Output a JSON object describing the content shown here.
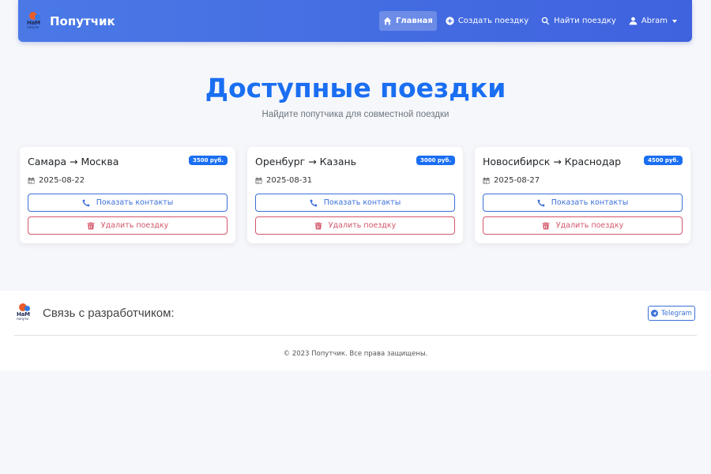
{
  "navbar": {
    "brand": "Попутчик",
    "logo_text": "НаМ",
    "logo_subtext": "попути",
    "items": [
      {
        "label": "Главная",
        "icon": "home-icon",
        "active": true
      },
      {
        "label": "Создать поездку",
        "icon": "plus-circle-icon",
        "active": false
      },
      {
        "label": "Найти поездку",
        "icon": "search-icon",
        "active": false
      },
      {
        "label": "Abram",
        "icon": "user-icon",
        "active": false
      }
    ]
  },
  "header": {
    "title": "Доступные поездки",
    "subtitle": "Найдите попутчика для совместной поездки"
  },
  "trips": [
    {
      "route": "Самара → Москва",
      "price": "3500 руб.",
      "date": "2025-08-22",
      "contacts_label": "Показать контакты",
      "delete_label": "Удалить поездку"
    },
    {
      "route": "Оренбург → Казань",
      "price": "3000 руб.",
      "date": "2025-08-31",
      "contacts_label": "Показать контакты",
      "delete_label": "Удалить поездку"
    },
    {
      "route": "Новосибирск → Краснодар",
      "price": "4500 руб.",
      "date": "2025-08-27",
      "contacts_label": "Показать контакты",
      "delete_label": "Удалить поездку"
    }
  ],
  "footer": {
    "contact_label": "Связь с разработчиком:",
    "telegram_label": "Telegram",
    "copyright": "© 2023 Попутчик. Все права защищены."
  },
  "colors": {
    "primary": "#1a6ef2",
    "navbar_start": "#4a79e6",
    "navbar_end": "#3f62de",
    "danger": "#d2566a"
  }
}
